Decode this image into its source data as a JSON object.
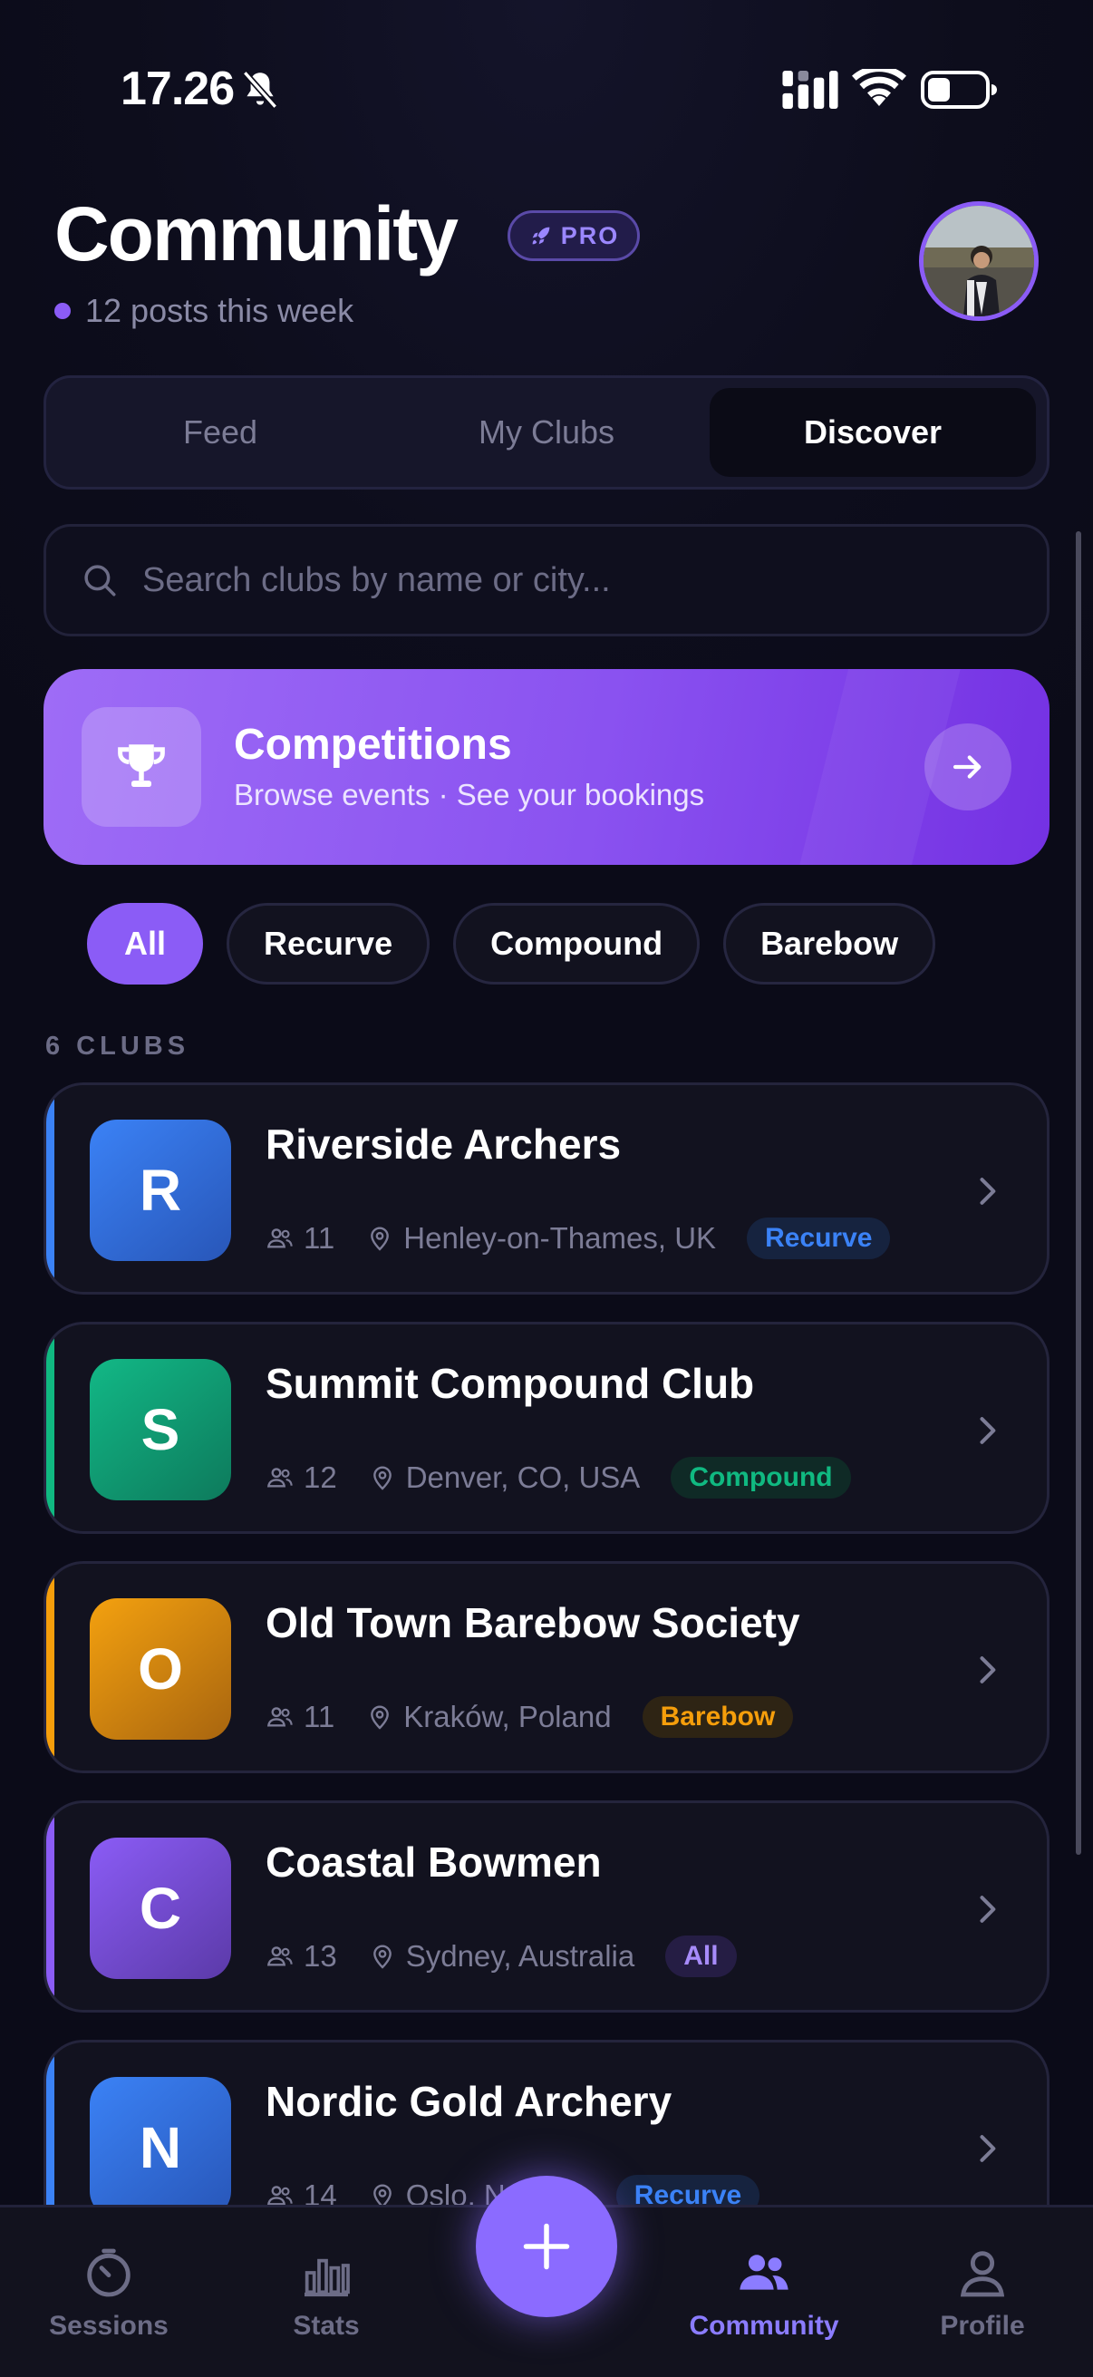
{
  "status_bar": {
    "time": "17.26"
  },
  "header": {
    "title": "Community",
    "badge": "PRO",
    "subtitle": "12 posts this week"
  },
  "tabs": [
    {
      "label": "Feed",
      "active": false
    },
    {
      "label": "My Clubs",
      "active": false
    },
    {
      "label": "Discover",
      "active": true
    }
  ],
  "search": {
    "placeholder": "Search clubs by name or city...",
    "value": ""
  },
  "banner": {
    "title": "Competitions",
    "subtitle": "Browse events · See your bookings"
  },
  "filters": [
    {
      "label": "All",
      "active": true
    },
    {
      "label": "Recurve",
      "active": false
    },
    {
      "label": "Compound",
      "active": false
    },
    {
      "label": "Barebow",
      "active": false
    }
  ],
  "clubs_count_label": "6 CLUBS",
  "clubs": [
    {
      "initial": "R",
      "name": "Riverside Archers",
      "members": "11",
      "city": "Henley-on-Thames, UK",
      "badge": "Recurve"
    },
    {
      "initial": "S",
      "name": "Summit Compound Club",
      "members": "12",
      "city": "Denver, CO, USA",
      "badge": "Compound"
    },
    {
      "initial": "O",
      "name": "Old Town Barebow Society",
      "members": "11",
      "city": "Kraków, Poland",
      "badge": "Barebow"
    },
    {
      "initial": "C",
      "name": "Coastal Bowmen",
      "members": "13",
      "city": "Sydney, Australia",
      "badge": "All"
    },
    {
      "initial": "N",
      "name": "Nordic Gold Archery",
      "members": "14",
      "city": "Oslo, Norway",
      "badge": "Recurve"
    }
  ],
  "badge_colors": {
    "Recurve": {
      "accent": "#3b82f6",
      "fg": "#3b82f6",
      "bg": "#16233f"
    },
    "Compound": {
      "accent": "#10b981",
      "fg": "#10b981",
      "bg": "#0f2a26"
    },
    "Barebow": {
      "accent": "#f59e0b",
      "fg": "#f59e0b",
      "bg": "#2e2414"
    },
    "All": {
      "accent": "#8b5cf6",
      "fg": "#a78bfa",
      "bg": "#251d44"
    }
  },
  "nav": [
    {
      "label": "Sessions",
      "icon": "timer-icon",
      "active": false
    },
    {
      "label": "Stats",
      "icon": "bar-chart-icon",
      "active": false
    },
    {
      "label": "Community",
      "icon": "people-icon",
      "active": true
    },
    {
      "label": "Profile",
      "icon": "person-icon",
      "active": false
    }
  ],
  "fab_icon": "plus-icon",
  "colors": {
    "accent": "#8b5cf6",
    "background": "#0b0b18"
  }
}
